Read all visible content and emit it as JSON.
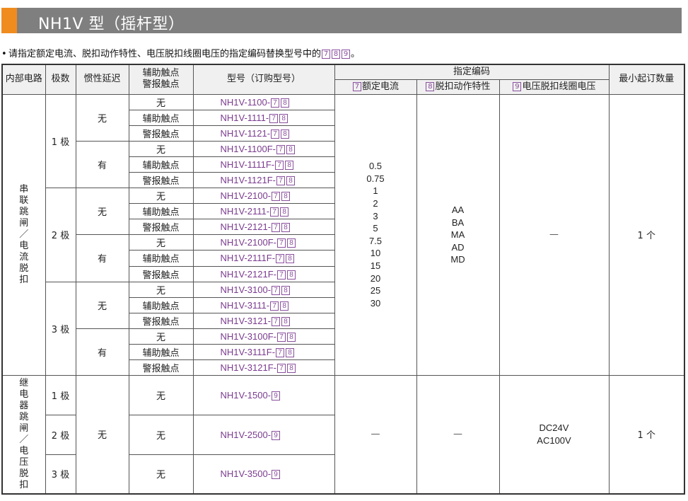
{
  "header": {
    "title": "NH1V 型（摇杆型）"
  },
  "note": {
    "prefix": "请指定额定电流、脱扣动作特性、电压脱扣线圈电压的指定编码替换型号中的",
    "codes": [
      "7",
      "8",
      "9"
    ],
    "suffix": "。"
  },
  "columns": {
    "internal_circuit": "内部电路",
    "poles": "极数",
    "inertia_delay": "惯性延迟",
    "aux_alarm_line1": "辅助触点",
    "aux_alarm_line2": "警报触点",
    "model": "型号（订购型号）",
    "designation": "指定编码",
    "rated_current": "额定电流",
    "trip_characteristic": "脱扣动作特性",
    "coil_voltage": "电压脱扣线圈电压",
    "min_order": "最小起订数量",
    "code7": "7",
    "code8": "8",
    "code9": "9"
  },
  "group_series": {
    "label": "串联跳闸／电流脱扣",
    "rated_current_values": [
      "0.5",
      "0.75",
      "1",
      "2",
      "3",
      "5",
      "7.5",
      "10",
      "15",
      "20",
      "25",
      "30"
    ],
    "trip_values": [
      "AA",
      "BA",
      "MA",
      "AD",
      "MD"
    ],
    "coil": "—",
    "min_order": "1 个",
    "poles": [
      {
        "label": "1 极",
        "delays": [
          {
            "label": "无",
            "rows": [
              {
                "contact": "无",
                "model": "NH1V-1100-"
              },
              {
                "contact": "辅助触点",
                "model": "NH1V-1111-"
              },
              {
                "contact": "警报触点",
                "model": "NH1V-1121-"
              }
            ]
          },
          {
            "label": "有",
            "rows": [
              {
                "contact": "无",
                "model": "NH1V-1100F-"
              },
              {
                "contact": "辅助触点",
                "model": "NH1V-1111F-"
              },
              {
                "contact": "警报触点",
                "model": "NH1V-1121F-"
              }
            ]
          }
        ]
      },
      {
        "label": "2 极",
        "delays": [
          {
            "label": "无",
            "rows": [
              {
                "contact": "无",
                "model": "NH1V-2100-"
              },
              {
                "contact": "辅助触点",
                "model": "NH1V-2111-"
              },
              {
                "contact": "警报触点",
                "model": "NH1V-2121-"
              }
            ]
          },
          {
            "label": "有",
            "rows": [
              {
                "contact": "无",
                "model": "NH1V-2100F-"
              },
              {
                "contact": "辅助触点",
                "model": "NH1V-2111F-"
              },
              {
                "contact": "警报触点",
                "model": "NH1V-2121F-"
              }
            ]
          }
        ]
      },
      {
        "label": "3 极",
        "delays": [
          {
            "label": "无",
            "rows": [
              {
                "contact": "无",
                "model": "NH1V-3100-"
              },
              {
                "contact": "辅助触点",
                "model": "NH1V-3111-"
              },
              {
                "contact": "警报触点",
                "model": "NH1V-3121-"
              }
            ]
          },
          {
            "label": "有",
            "rows": [
              {
                "contact": "无",
                "model": "NH1V-3100F-"
              },
              {
                "contact": "辅助触点",
                "model": "NH1V-3111F-"
              },
              {
                "contact": "警报触点",
                "model": "NH1V-3121F-"
              }
            ]
          }
        ]
      }
    ]
  },
  "group_relay": {
    "label": "继电器跳闸／电压脱扣",
    "delay": "无",
    "rated_current": "—",
    "trip": "—",
    "coil_values": [
      "DC24V",
      "AC100V"
    ],
    "min_order": "1 个",
    "rows": [
      {
        "pole": "1 极",
        "contact": "无",
        "model": "NH1V-1500-"
      },
      {
        "pole": "2 极",
        "contact": "无",
        "model": "NH1V-2500-"
      },
      {
        "pole": "3 极",
        "contact": "无",
        "model": "NH1V-3500-"
      }
    ]
  }
}
